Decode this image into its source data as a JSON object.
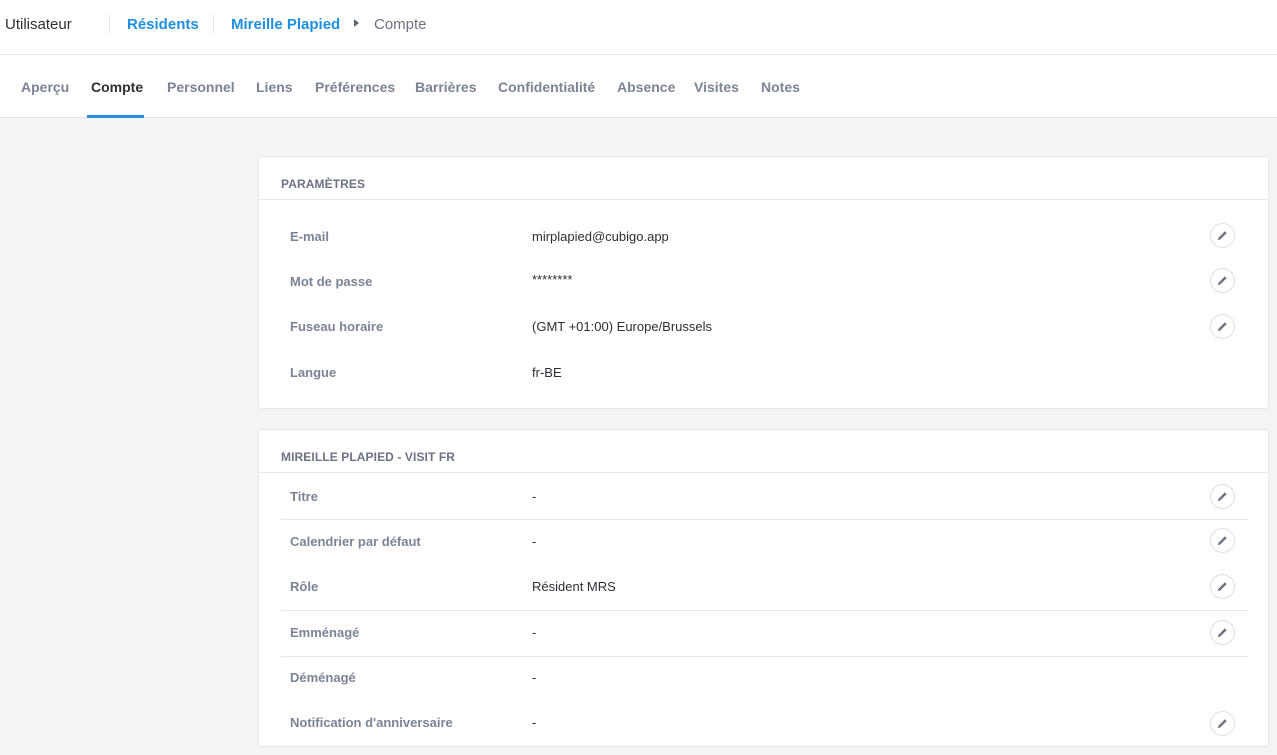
{
  "topbar": {
    "app_title": "Utilisateur",
    "breadcrumb": {
      "residents": "Résidents",
      "person": "Mireille Plapied",
      "current": "Compte"
    }
  },
  "tabs": [
    {
      "label": "Aperçu",
      "active": false
    },
    {
      "label": "Compte",
      "active": true
    },
    {
      "label": "Personnel",
      "active": false
    },
    {
      "label": "Liens",
      "active": false
    },
    {
      "label": "Préférences",
      "active": false
    },
    {
      "label": "Barrières",
      "active": false
    },
    {
      "label": "Confidentialité",
      "active": false
    },
    {
      "label": "Absence",
      "active": false
    },
    {
      "label": "Visites",
      "active": false
    },
    {
      "label": "Notes",
      "active": false
    }
  ],
  "settings": {
    "title": "PARAMÈTRES",
    "rows": [
      {
        "label": "E-mail",
        "value": "mirplapied@cubigo.app",
        "editable": true
      },
      {
        "label": "Mot de passe",
        "value": "********",
        "editable": true
      },
      {
        "label": "Fuseau horaire",
        "value": "(GMT +01:00) Europe/Brussels",
        "editable": true
      },
      {
        "label": "Langue",
        "value": "fr-BE",
        "editable": false
      }
    ]
  },
  "site": {
    "title": "MIREILLE PLAPIED - VISIT FR",
    "rows": [
      {
        "label": "Titre",
        "value": "-",
        "editable": true
      },
      {
        "label": "Calendrier par défaut",
        "value": "-",
        "editable": true
      },
      {
        "label": "Rôle",
        "value": "Résident MRS",
        "editable": true
      },
      {
        "label": "Emménagé",
        "value": "-",
        "editable": true
      },
      {
        "label": "Déménagé",
        "value": "-",
        "editable": false
      },
      {
        "label": "Notification d'anniversaire",
        "value": "-",
        "editable": true
      }
    ]
  },
  "icons": {
    "edit": "pencil-icon",
    "breadcrumb_separator": "caret-right-icon"
  },
  "colors": {
    "link": "#1f8fe0",
    "active_tab_underline": "#2a8fdf",
    "page_bg": "#f3f4f6"
  }
}
